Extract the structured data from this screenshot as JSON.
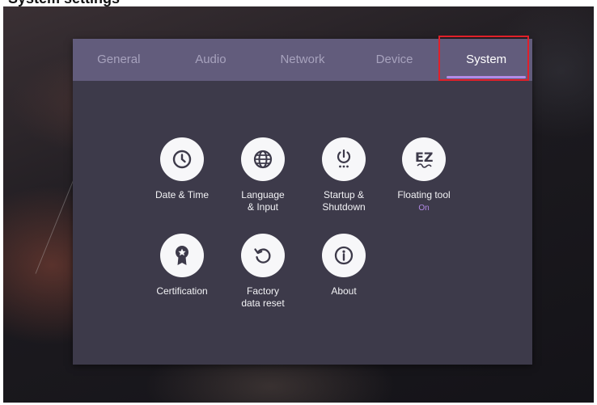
{
  "heading_cropped": "System settings",
  "tabs": [
    {
      "label": "General"
    },
    {
      "label": "Audio"
    },
    {
      "label": "Network"
    },
    {
      "label": "Device"
    },
    {
      "label": "System"
    }
  ],
  "active_tab": "System",
  "items": {
    "date_time": {
      "label": "Date & Time",
      "icon": "clock-icon"
    },
    "language": {
      "label_1": "Language",
      "label_2": "& Input",
      "icon": "globe-icon"
    },
    "startup": {
      "label_1": "Startup &",
      "label_2": "Shutdown",
      "icon": "power-icon"
    },
    "floating": {
      "label": "Floating tool",
      "status": "On",
      "icon": "ez-icon"
    },
    "certification": {
      "label": "Certification",
      "icon": "certificate-icon"
    },
    "factory": {
      "label_1": "Factory",
      "label_2": "data reset",
      "icon": "reset-icon"
    },
    "about": {
      "label": "About",
      "icon": "info-icon"
    }
  },
  "colors": {
    "panel": "#3d3a4a",
    "tabbar": "#625c7c",
    "accent": "#b28ae6",
    "highlight": "#e0202a"
  }
}
